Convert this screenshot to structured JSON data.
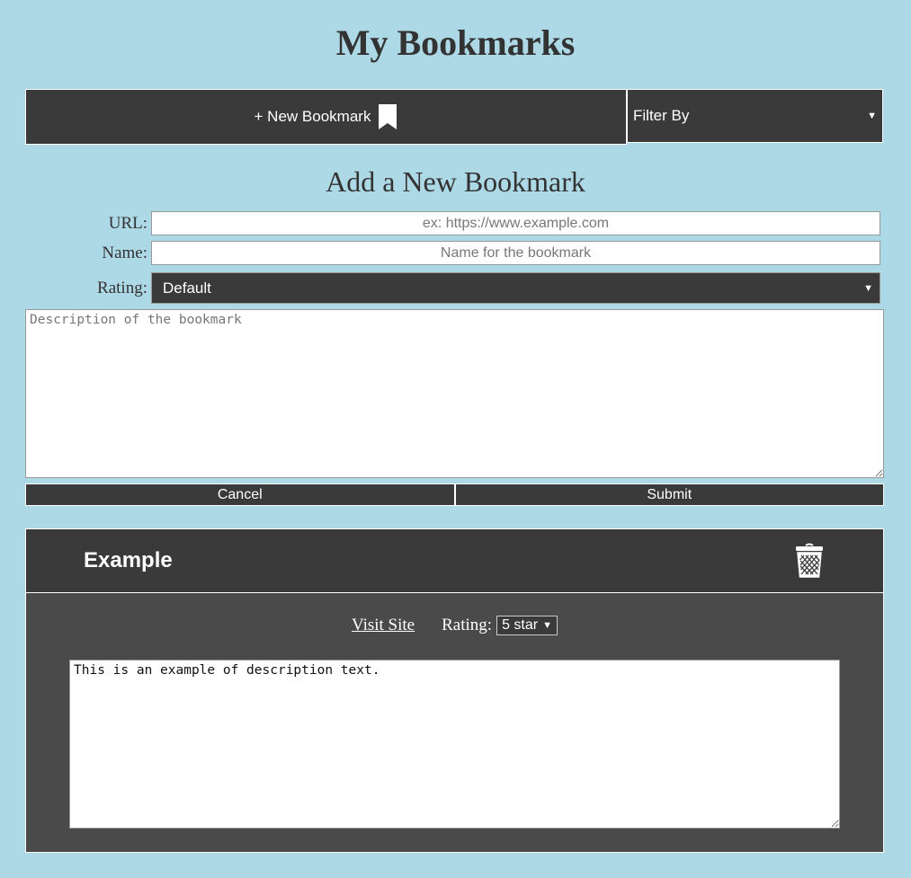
{
  "page": {
    "title": "My Bookmarks"
  },
  "toolbar": {
    "new_label": "+ New Bookmark",
    "filter_label": "Filter By",
    "bookmark_icon": "bookmark-icon"
  },
  "form": {
    "title": "Add a New Bookmark",
    "url_label": "URL:",
    "url_placeholder": "ex: https://www.example.com",
    "name_label": "Name:",
    "name_placeholder": "Name for the bookmark",
    "rating_label": "Rating:",
    "rating_value": "Default",
    "description_placeholder": "Description of the bookmark",
    "cancel_label": "Cancel",
    "submit_label": "Submit"
  },
  "bookmarks": [
    {
      "title": "Example",
      "visit_label": "Visit Site",
      "rating_label": "Rating:",
      "rating_value": "5 star",
      "description": "This is an example of description text.",
      "delete_icon": "trash-icon"
    }
  ],
  "colors": {
    "background": "#add8e6",
    "panel": "#3a3a3a",
    "card_body": "#4a4a4a",
    "text_dark": "#333333"
  }
}
